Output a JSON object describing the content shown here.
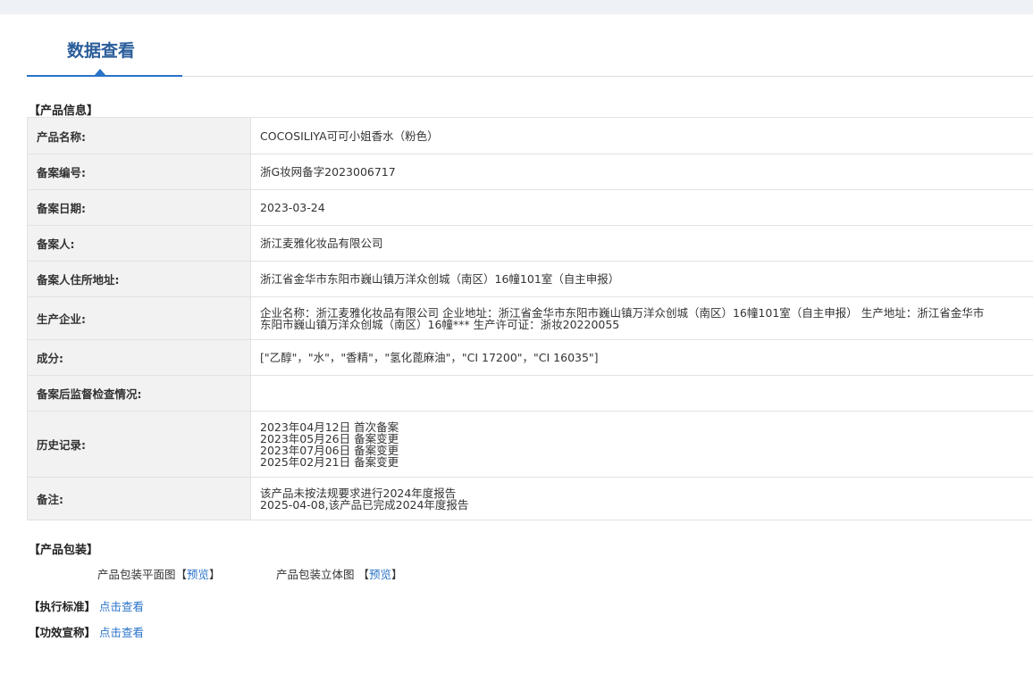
{
  "tab": {
    "title": "数据查看"
  },
  "product_info": {
    "section_title": "【产品信息】",
    "rows": [
      {
        "label": "产品名称:",
        "value": [
          "COCOSILIYA可可小姐香水（粉色）"
        ]
      },
      {
        "label": "备案编号:",
        "value": [
          "浙G妆网备字2023006717"
        ]
      },
      {
        "label": "备案日期:",
        "value": [
          "2023-03-24"
        ]
      },
      {
        "label": "备案人:",
        "value": [
          "浙江麦雅化妆品有限公司"
        ]
      },
      {
        "label": "备案人住所地址:",
        "value": [
          "浙江省金华市东阳市巍山镇万洋众创城（南区）16幢101室（自主申报）"
        ]
      },
      {
        "label": "生产企业:",
        "value": [
          "企业名称：浙江麦雅化妆品有限公司 企业地址：浙江省金华市东阳市巍山镇万洋众创城（南区）16幢101室（自主申报） 生产地址：浙江省金华市东阳市巍山镇万洋众创城（南区）16幢*** 生产许可证：浙妆20220055"
        ]
      },
      {
        "label": "成分:",
        "value": [
          "[\"乙醇\"，\"水\"，\"香精\"，\"氢化蓖麻油\"，\"CI 17200\"，\"CI 16035\"]"
        ]
      },
      {
        "label": "备案后监督检查情况:",
        "value": [
          ""
        ]
      },
      {
        "label": "历史记录:",
        "value": [
          "2023年04月12日 首次备案",
          "2023年05月26日 备案变更",
          "2023年07月06日 备案变更",
          "2025年02月21日 备案变更"
        ]
      },
      {
        "label": "备注:",
        "value": [
          "该产品未按法规要求进行2024年度报告",
          "2025-04-08,该产品已完成2024年度报告"
        ]
      }
    ]
  },
  "packaging": {
    "section_title": "【产品包装】",
    "flat_label": "产品包装平面图【",
    "flat_link": "预览",
    "flat_close": "】",
    "solid_label": "产品包装立体图 【",
    "solid_link": "预览",
    "solid_close": "】"
  },
  "standard": {
    "label": "【执行标准】",
    "link": "点击查看"
  },
  "efficacy": {
    "label": "【功效宣称】",
    "link": "点击查看"
  }
}
